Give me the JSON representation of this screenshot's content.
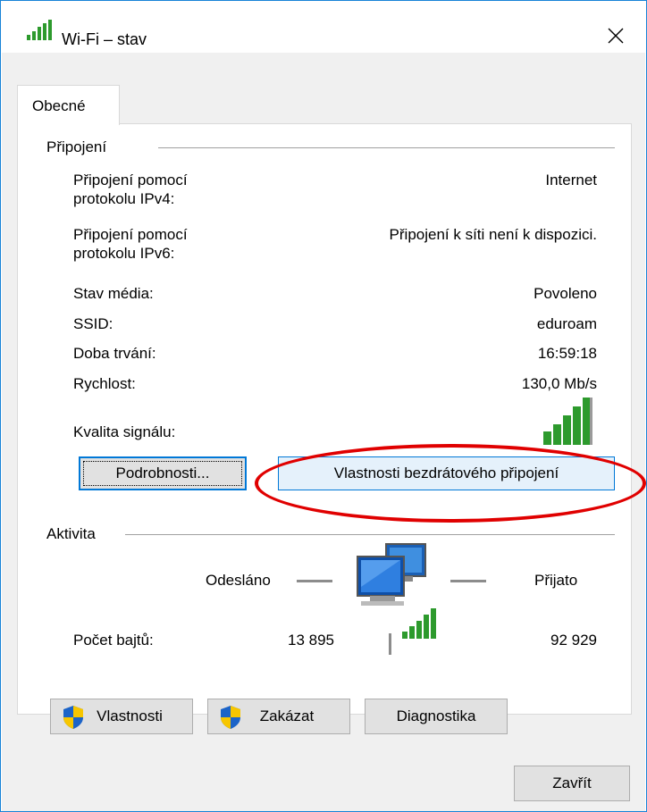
{
  "window": {
    "title": "Wi-Fi – stav"
  },
  "tabs": [
    {
      "label": "Obecné",
      "selected": true
    }
  ],
  "connection": {
    "group_label": "Připojení",
    "rows": [
      {
        "label": "Připojení pomocí\nprotokolu IPv4:",
        "value": "Internet"
      },
      {
        "label": "Připojení pomocí\nprotokolu IPv6:",
        "value": "Připojení k síti není k dispozici."
      },
      {
        "label": "Stav média:",
        "value": "Povoleno"
      },
      {
        "label": "SSID:",
        "value": "eduroam"
      },
      {
        "label": "Doba trvání:",
        "value": "16:59:18"
      },
      {
        "label": "Rychlost:",
        "value": "130,0 Mb/s"
      }
    ],
    "signal_label": "Kvalita signálu:",
    "signal_bars": 5,
    "details_button": "Podrobnosti...",
    "wireless_properties_button": "Vlastnosti bezdrátového připojení"
  },
  "activity": {
    "group_label": "Aktivita",
    "sent_label": "Odesláno",
    "received_label": "Přijato",
    "bytes_label": "Počet bajtů:",
    "bytes_sent": "13 895",
    "bytes_received": "92 929"
  },
  "buttons": {
    "properties": "Vlastnosti",
    "disable": "Zakázat",
    "diagnose": "Diagnostika",
    "close": "Zavřít"
  },
  "colors": {
    "accent": "#0078d7",
    "window_border": "#1883d7",
    "annotation": "#e00000",
    "signal_green": "#2d9a2d"
  }
}
